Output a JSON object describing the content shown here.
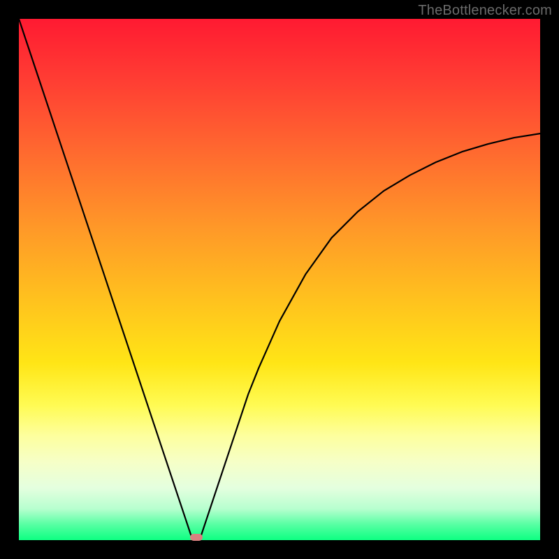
{
  "watermark": "TheBottlenecker.com",
  "chart_data": {
    "type": "line",
    "title": "",
    "xlabel": "",
    "ylabel": "",
    "xlim": [
      0,
      100
    ],
    "ylim": [
      0,
      100
    ],
    "x": [
      0,
      2,
      4,
      6,
      8,
      10,
      12,
      14,
      16,
      18,
      20,
      22,
      24,
      26,
      28,
      30,
      32,
      33,
      34,
      35,
      36,
      38,
      40,
      42,
      44,
      46,
      50,
      55,
      60,
      65,
      70,
      75,
      80,
      85,
      90,
      95,
      100
    ],
    "values": [
      100,
      94,
      88,
      82,
      76,
      70,
      64,
      58,
      52,
      46,
      40,
      34,
      28,
      22,
      16,
      10,
      4,
      1,
      0,
      1,
      4,
      10,
      16,
      22,
      28,
      33,
      42,
      51,
      58,
      63,
      67,
      70,
      72.5,
      74.5,
      76,
      77.2,
      78
    ],
    "marker": {
      "x": 34,
      "y": 0.5
    },
    "gradient_stops": [
      {
        "pos": 0,
        "color": "#ff1a32"
      },
      {
        "pos": 100,
        "color": "#0dff82"
      }
    ]
  }
}
